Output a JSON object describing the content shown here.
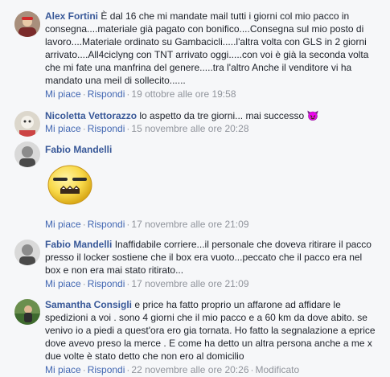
{
  "comments": [
    {
      "author": "Alex Fortini",
      "text": "È dal 16 che mi mandate mail tutti i giorni col mio pacco in consegna....materiale già pagato con bonifico....Consegna sul mio posto di lavoro....Materiale ordinato su Gambacicli.....l'altra volta con GLS in 2 giorni arrivato....All4ciclyng con TNT arrivato oggi.....con voi è già la seconda volta che mi fate una manfrina del genere.....tra l'altro Anche il venditore vi ha mandato una meil di sollecito......",
      "like": "Mi piace",
      "reply": "Rispondi",
      "time": "19 ottobre alle ore 19:58"
    },
    {
      "author": "Nicoletta Vettorazzo",
      "text": "lo aspetto da tre giorni... mai successo",
      "emoji": "😈",
      "like": "Mi piace",
      "reply": "Rispondi",
      "time": "15 novembre alle ore 20:28"
    },
    {
      "author": "Fabio Mandelli",
      "sticker": "grimacing-sticker",
      "like": "Mi piace",
      "reply": "Rispondi",
      "time": "17 novembre alle ore 21:09"
    },
    {
      "author": "Fabio Mandelli",
      "text": "Inaffidabile corriere...il personale che doveva ritirare il pacco presso il locker sostiene che il box era vuoto...peccato che il pacco era nel box e non era mai stato ritirato...",
      "like": "Mi piace",
      "reply": "Rispondi",
      "time": "17 novembre alle ore 21:09"
    },
    {
      "author": "Samantha Consigli",
      "text": "e price ha fatto proprio un affarone ad affidare le spedizioni a voi . sono 4 giorni che il mio pacco e a 60 km da dove abito. se venivo io a piedi a quest'ora ero gia tornata. Ho fatto la segnalazione a eprice dove avevo preso la merce . E come ha detto un altra persona anche a me x due volte è stato detto che non ero al domicilio",
      "like": "Mi piace",
      "reply": "Rispondi",
      "time": "22 novembre alle ore 20:26",
      "edited": "Modificato"
    }
  ],
  "separator": "·",
  "colors": {
    "link": "#385898",
    "meta": "#90949c",
    "background": "#f6f7f9"
  }
}
